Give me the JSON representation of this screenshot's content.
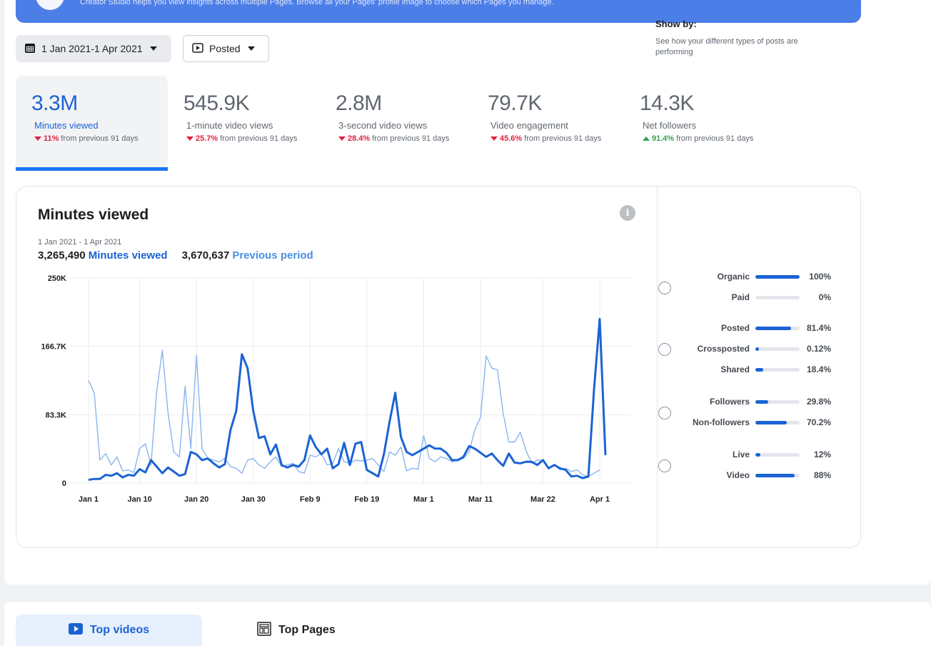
{
  "banner": {
    "text": "Creator Studio helps you view insights across multiple Pages. Browse all your Pages' profile image to choose which Pages you manage."
  },
  "filters": {
    "date_range": "1 Jan 2021-1 Apr 2021",
    "post_type": "Posted",
    "date_icon": "calendar-icon",
    "post_icon": "video-play-icon"
  },
  "metrics": [
    {
      "value": "3.3M",
      "label": "Minutes viewed",
      "change": "11%",
      "suffix": "from previous 91 days",
      "direction": "down"
    },
    {
      "value": "545.9K",
      "label": "1-minute video views",
      "change": "25.7%",
      "suffix": "from previous 91 days",
      "direction": "down"
    },
    {
      "value": "2.8M",
      "label": "3-second video views",
      "change": "28.4%",
      "suffix": "from previous 91 days",
      "direction": "down"
    },
    {
      "value": "79.7K",
      "label": "Video engagement",
      "change": "45.6%",
      "suffix": "from previous 91 days",
      "direction": "down"
    },
    {
      "value": "14.3K",
      "label": "Net followers",
      "change": "91.4%",
      "suffix": "from previous 91 days",
      "direction": "up"
    }
  ],
  "panel": {
    "title": "Minutes viewed",
    "date_range": "1 Jan 2021 - 1 Apr 2021",
    "current_total": "3,265,490",
    "current_label": "Minutes viewed",
    "previous_total": "3,670,637",
    "previous_label": "Previous period"
  },
  "showby": {
    "title": "Show by:",
    "subtitle": "See how your different types of posts are performing",
    "groups": [
      {
        "rows": [
          {
            "label": "Organic",
            "value": "100%",
            "pct": 100
          },
          {
            "label": "Paid",
            "value": "0%",
            "pct": 0
          }
        ]
      },
      {
        "rows": [
          {
            "label": "Posted",
            "value": "81.4%",
            "pct": 81.4
          },
          {
            "label": "Crossposted",
            "value": "0.12%",
            "pct": 0.12
          },
          {
            "label": "Shared",
            "value": "18.4%",
            "pct": 18.4
          }
        ]
      },
      {
        "rows": [
          {
            "label": "Followers",
            "value": "29.8%",
            "pct": 29.8
          },
          {
            "label": "Non-followers",
            "value": "70.2%",
            "pct": 70.2
          }
        ]
      },
      {
        "rows": [
          {
            "label": "Live",
            "value": "12%",
            "pct": 12
          },
          {
            "label": "Video",
            "value": "88%",
            "pct": 88
          }
        ]
      }
    ]
  },
  "tabs": {
    "top_videos": "Top videos",
    "top_pages": "Top Pages"
  },
  "colors": {
    "current_series": "#1b63d4",
    "previous_series": "#8ab4ef",
    "accent": "#1877f2"
  },
  "chart_data": {
    "type": "line",
    "ylim": [
      0,
      250000
    ],
    "yticks": [
      "0",
      "83.3K",
      "166.7K",
      "250K"
    ],
    "ytick_values": [
      0,
      83333,
      166667,
      250000
    ],
    "xticks": [
      "Jan 1",
      "Jan 10",
      "Jan 20",
      "Jan 30",
      "Feb 9",
      "Feb 19",
      "Mar 1",
      "Mar 11",
      "Mar 22",
      "Apr 1"
    ],
    "xtick_days": [
      0,
      9,
      19,
      29,
      39,
      49,
      59,
      69,
      80,
      90
    ],
    "grid": true,
    "series": [
      {
        "name": "Previous period",
        "values": [
          125000,
          110000,
          28000,
          36000,
          22000,
          32000,
          15000,
          16000,
          13000,
          42000,
          48000,
          22000,
          112000,
          162000,
          85000,
          38000,
          32000,
          118000,
          42000,
          156000,
          42000,
          30000,
          28000,
          26000,
          30000,
          20000,
          18000,
          12000,
          28000,
          30000,
          22000,
          18000,
          26000,
          32000,
          20000,
          22000,
          24000,
          14000,
          12000,
          34000,
          32000,
          36000,
          22000,
          24000,
          42000,
          26000,
          24000,
          28000,
          27000,
          28000,
          30000,
          22000,
          14000,
          38000,
          34000,
          44000,
          15000,
          18000,
          17000,
          58000,
          30000,
          26000,
          32000,
          30000,
          26000,
          28000,
          30000,
          38000,
          65000,
          80000,
          155000,
          140000,
          138000,
          85000,
          50000,
          50000,
          62000,
          40000,
          24000,
          28000,
          28000,
          18000,
          22000,
          16000,
          18000,
          14000,
          16000,
          10000,
          8000,
          12000,
          16000
        ]
      },
      {
        "name": "Minutes viewed",
        "values": [
          4000,
          5000,
          5000,
          10000,
          9000,
          12000,
          7000,
          10000,
          9000,
          17000,
          13000,
          28000,
          20000,
          12000,
          19000,
          14000,
          9000,
          11000,
          38000,
          35000,
          28000,
          30000,
          24000,
          19000,
          23000,
          65000,
          88000,
          157000,
          140000,
          88000,
          55000,
          57000,
          35000,
          47000,
          22000,
          19000,
          22000,
          20000,
          28000,
          58000,
          44000,
          35000,
          42000,
          18000,
          23000,
          49000,
          22000,
          48000,
          50000,
          16000,
          12000,
          8000,
          35000,
          75000,
          110000,
          56000,
          38000,
          34000,
          38000,
          42000,
          46000,
          42000,
          42000,
          37000,
          28000,
          28000,
          32000,
          45000,
          42000,
          37000,
          32000,
          36000,
          28000,
          21000,
          36000,
          25000,
          24000,
          26000,
          26000,
          22000,
          28000,
          18000,
          22000,
          18000,
          16000,
          8000,
          9000,
          6000,
          8000,
          115000,
          200000,
          34000
        ]
      }
    ]
  }
}
